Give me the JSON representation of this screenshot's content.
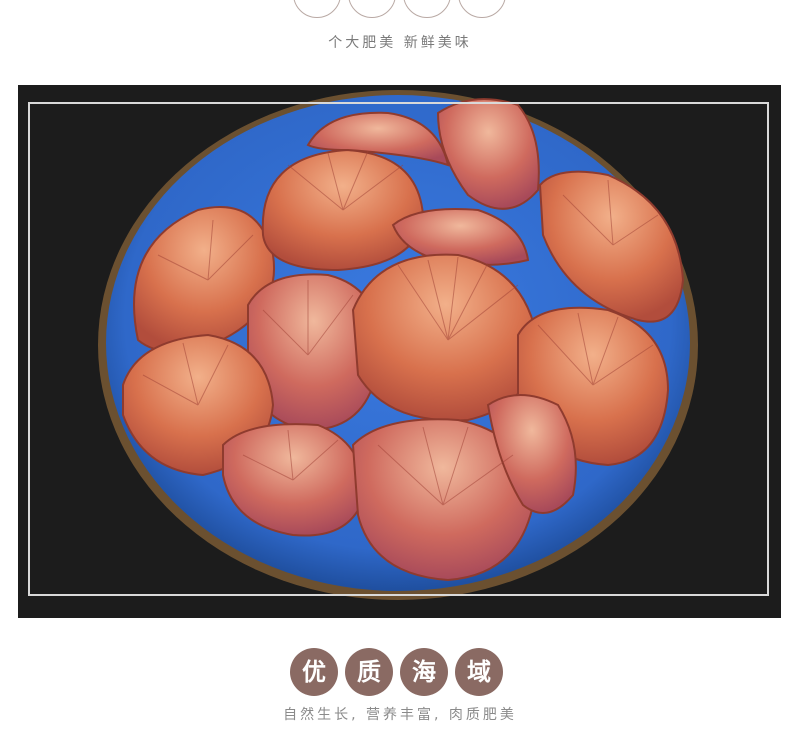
{
  "top": {
    "caption": "个大肥美 新鲜美味"
  },
  "photo": {
    "subject": "scallops-on-blue-plate"
  },
  "bottom": {
    "badges": [
      "优",
      "质",
      "海",
      "域"
    ],
    "caption": "自然生长, 营养丰富, 肉质肥美"
  },
  "colors": {
    "badge": "#8a6a63",
    "background_photo": "#1c1c1c",
    "plate": "#2f68c9"
  }
}
